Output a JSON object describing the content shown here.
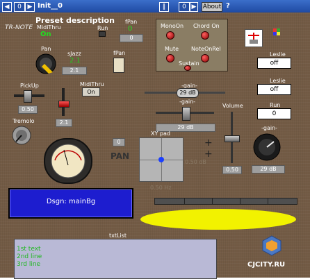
{
  "titlebar": {
    "counter": "0",
    "preset_name": "Init__0",
    "pause_symbol": "‖",
    "counter2": "0",
    "about_label": "About",
    "help_label": "?"
  },
  "header": {
    "preset_description": "Preset description",
    "product": "TR-NOTE"
  },
  "controls": {
    "midithru_top_label": "MidiThru",
    "midithru_top_value": "On",
    "run_label": "Run",
    "fpan_top_label": "fPan",
    "fpan_top_value": "0",
    "fpan_top_num": "0",
    "pan_label": "Pan",
    "sjazz_label": "sJazz",
    "sjazz_value": "2.1",
    "sjazz_box": "2.1",
    "fpan_label": "fPan",
    "pickup_label": "PickUp",
    "pickup_value": "0.50",
    "midithru_label": "MidiThru",
    "midithru_value": "On",
    "fader_value": "2.1",
    "tremolo_label": "Tremolo",
    "pan_big_label": "PAN",
    "pan_big_value": "0",
    "xypad_label": "XY pad",
    "xy_value_right": "0.50 dB",
    "xy_value_bottom": "0.50 Hz",
    "gain1_label": "-gain-",
    "gain1_value": "29 dB",
    "gain2_label": "-gain-",
    "gain2_value": "29 dB",
    "volume_label": "Volume",
    "volume_value": "0.50",
    "gain3_label": "-gain-",
    "gain3_value": "29 dB"
  },
  "fx_box": {
    "monoon": "MonoOn",
    "chordon": "Chord On",
    "mute": "Mute",
    "noteonrel": "NoteOnRel",
    "sustain": "Sustain"
  },
  "leslie1": {
    "label": "Leslie",
    "value": "off"
  },
  "leslie2": {
    "label": "Leslie",
    "value": "off"
  },
  "run_right": {
    "label": "Run",
    "value": "0"
  },
  "design_bar": {
    "text": "Dsgn: mainBg"
  },
  "txtlist": {
    "label": "txtList",
    "lines": [
      "1st text",
      "2nd line",
      "3rd line"
    ]
  },
  "watermark": "CJCITY.RU",
  "colors": {
    "panel": "#735b45",
    "blue": "#1d1dcf",
    "yellow": "#f2f200",
    "green_text": "#22cc22"
  }
}
